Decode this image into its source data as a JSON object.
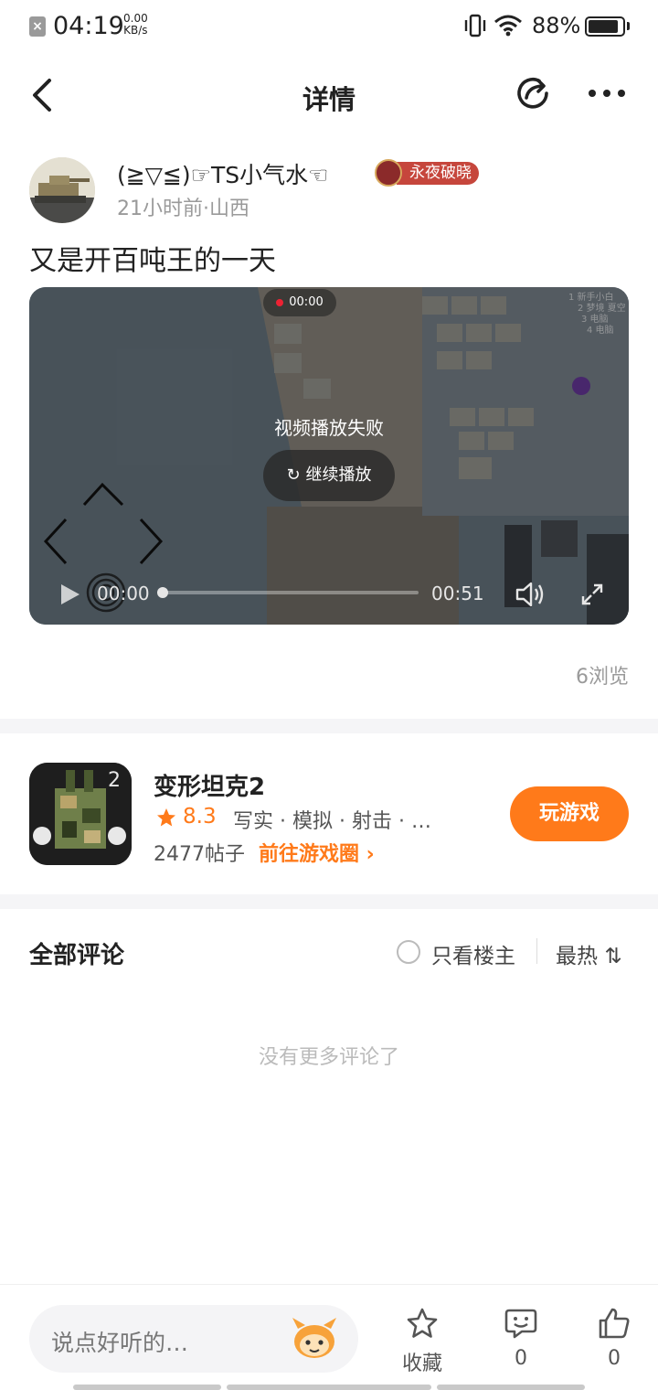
{
  "status_bar": {
    "time": "04:19",
    "speed_value": "0.00",
    "speed_unit": "KB/s",
    "battery": "88%",
    "battery_level": 0.88
  },
  "nav": {
    "title": "详情",
    "icons": [
      "back-arrow-icon",
      "share-icon",
      "more-icon"
    ]
  },
  "post": {
    "author": "(≧▽≦)☞TS小气水☜",
    "badge": "永夜破晓",
    "meta": "21小时前·山西",
    "title": "又是开百吨王的一天",
    "views": "6浏览"
  },
  "video": {
    "rec_time": "00:00",
    "error": "视频播放失败",
    "retry": "继续播放",
    "current_time": "00:00",
    "total_time": "00:51",
    "progress": 0
  },
  "game": {
    "name": "变形坦克2",
    "rating": "8.3",
    "tags": "写实 · 模拟 · 射击 · …",
    "posts": "2477帖子",
    "link": "前往游戏圈",
    "play": "玩游戏"
  },
  "comments": {
    "title": "全部评论",
    "only_op": "只看楼主",
    "sort": "最热",
    "empty": "没有更多评论了"
  },
  "bottom_bar": {
    "placeholder": "说点好听的…",
    "favorite": "收藏",
    "comment_count": "0",
    "like_count": "0"
  },
  "colors": {
    "accent": "#ff7a1a",
    "badge": "#c6463c",
    "text": "#222222",
    "muted": "#9a9a9a"
  }
}
